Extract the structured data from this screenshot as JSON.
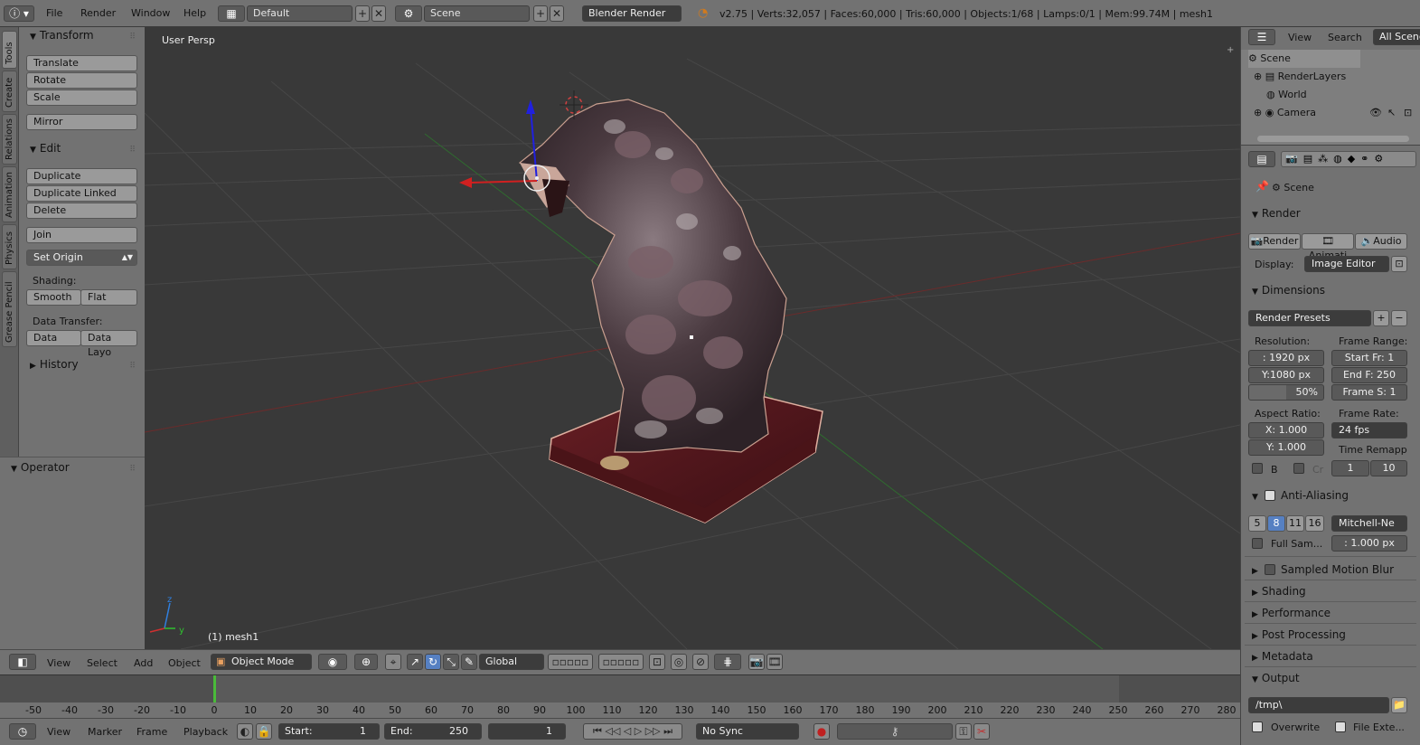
{
  "topbar": {
    "menus": [
      "File",
      "Render",
      "Window",
      "Help"
    ],
    "layout": "Default",
    "scene": "Scene",
    "engine": "Blender Render",
    "stats": "v2.75 | Verts:32,057 | Faces:60,000 | Tris:60,000 | Objects:1/68 | Lamps:0/1 | Mem:99.74M | mesh1"
  },
  "tabs": [
    "Tools",
    "Create",
    "Relations",
    "Animation",
    "Physics",
    "Grease Pencil"
  ],
  "toolshelf": {
    "transform": {
      "title": "Transform",
      "buttons": [
        "Translate",
        "Rotate",
        "Scale"
      ],
      "mirror": "Mirror"
    },
    "edit": {
      "title": "Edit",
      "buttons": [
        "Duplicate",
        "Duplicate Linked",
        "Delete"
      ],
      "join": "Join",
      "set_origin": "Set Origin",
      "shading_label": "Shading:",
      "smooth": "Smooth",
      "flat": "Flat",
      "data_transfer_label": "Data Transfer:",
      "data": "Data",
      "data_layo": "Data Layo"
    },
    "history": "History"
  },
  "operator": "Operator",
  "viewport": {
    "label": "User Persp",
    "object": "(1) mesh1"
  },
  "view_header": {
    "menus": [
      "View",
      "Select",
      "Add",
      "Object"
    ],
    "mode": "Object Mode",
    "orientation": "Global"
  },
  "timeline": {
    "ticks": [
      "-50",
      "-40",
      "-30",
      "-20",
      "-10",
      "0",
      "10",
      "20",
      "30",
      "40",
      "50",
      "60",
      "70",
      "80",
      "90",
      "100",
      "110",
      "120",
      "130",
      "140",
      "150",
      "160",
      "170",
      "180",
      "190",
      "200",
      "210",
      "220",
      "230",
      "240",
      "250",
      "260",
      "270",
      "280"
    ],
    "menus": [
      "View",
      "Marker",
      "Frame",
      "Playback"
    ],
    "start_label": "Start:",
    "start": "1",
    "end_label": "End:",
    "end": "250",
    "current": "1",
    "sync": "No Sync"
  },
  "outliner": {
    "header": {
      "view": "View",
      "search": "Search",
      "all_scenes": "All Scene"
    },
    "items": [
      "Scene",
      "RenderLayers",
      "World",
      "Camera"
    ]
  },
  "properties": {
    "context": "Scene",
    "render": {
      "title": "Render",
      "render_btn": "Render",
      "anim_btn": "Animati",
      "audio_btn": "Audio",
      "display_label": "Display:",
      "display": "Image Editor"
    },
    "dimensions": {
      "title": "Dimensions",
      "presets": "Render Presets",
      "resolution_label": "Resolution:",
      "frame_range_label": "Frame Range:",
      "res_x": "1920 px",
      "res_y": "Y:1080 px",
      "res_pct": "50%",
      "start_fr": "Start Fr: 1",
      "end_fr": "End F: 250",
      "frame_step": "Frame S: 1",
      "aspect_label": "Aspect Ratio:",
      "frame_rate_label": "Frame Rate:",
      "aspect_x": "1.000",
      "aspect_y": "1.000",
      "fps": "24 fps",
      "time_remap_label": "Time Remapp",
      "b_label": "B",
      "cr_label": "Cr",
      "remap_old": "1",
      "remap_new": "10"
    },
    "anti_aliasing": {
      "title": "Anti-Aliasing",
      "samples": [
        "5",
        "8",
        "11",
        "16"
      ],
      "filter": "Mitchell-Ne",
      "full_sample": "Full Sam...",
      "filter_size": ": 1.000 px"
    },
    "collapsed": [
      "Sampled Motion Blur",
      "Shading",
      "Performance",
      "Post Processing",
      "Metadata"
    ],
    "output": {
      "title": "Output",
      "path": "/tmp\\",
      "overwrite": "Overwrite",
      "file_ext": "File Exte..."
    }
  }
}
